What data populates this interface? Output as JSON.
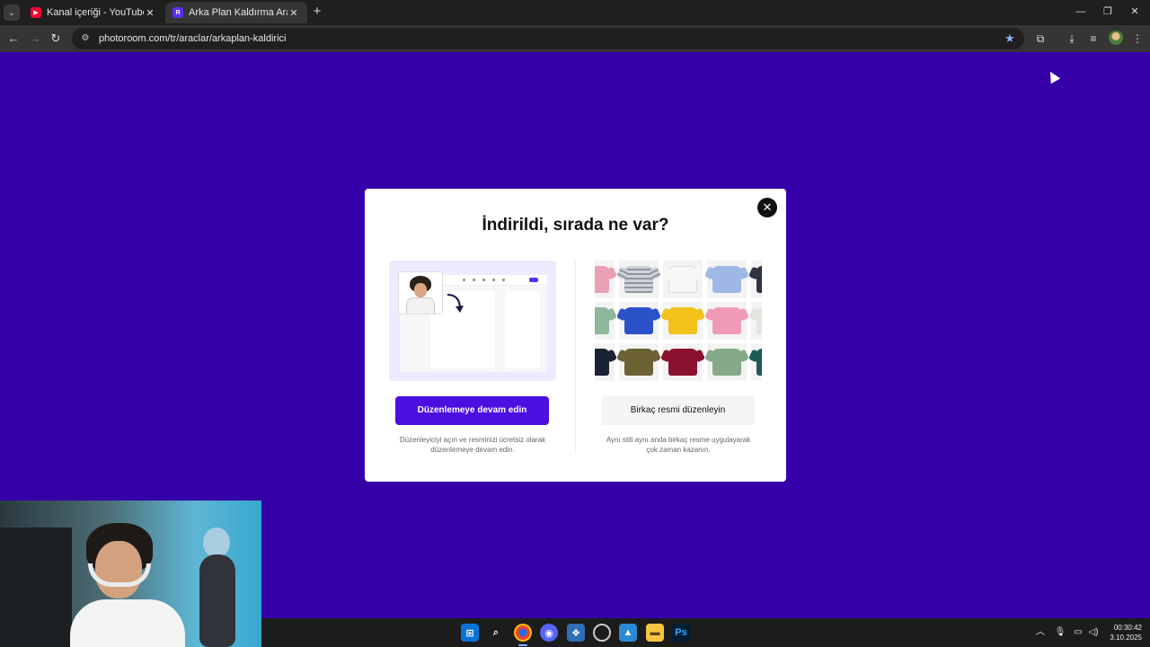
{
  "browser": {
    "tabs": [
      {
        "title": "Kanal içeriği - YouTube Studio",
        "favicon": "youtube-icon"
      },
      {
        "title": "Arka Plan Kaldırma Aracı: Ücreti",
        "favicon": "photoroom-icon"
      }
    ],
    "close_glyph": "✕",
    "new_tab_glyph": "+",
    "url": "photoroom.com/tr/araclar/arkaplan-kaldirici",
    "window_controls": [
      "—",
      "❐",
      "✕"
    ]
  },
  "modal": {
    "title": "İndirildi, sırada ne var?",
    "close_glyph": "✕",
    "left_option": {
      "button": "Düzenlemeye devam edin",
      "description_line1": "Düzenleyiciyi açın ve resminizi ücretsiz olarak",
      "description_line2": "düzenlemeye devam edin."
    },
    "right_option": {
      "button": "Birkaç resmi düzenleyin",
      "description_line1": "Aynı stili aynı anda birkaç resme uygulayarak",
      "description_line2": "çok zaman kazanın."
    }
  },
  "taskbar": {
    "time": "00:30:42",
    "date": "3.10.2025"
  },
  "colors": {
    "page_background": "#3600a8",
    "primary_button": "#4b0fe0"
  }
}
